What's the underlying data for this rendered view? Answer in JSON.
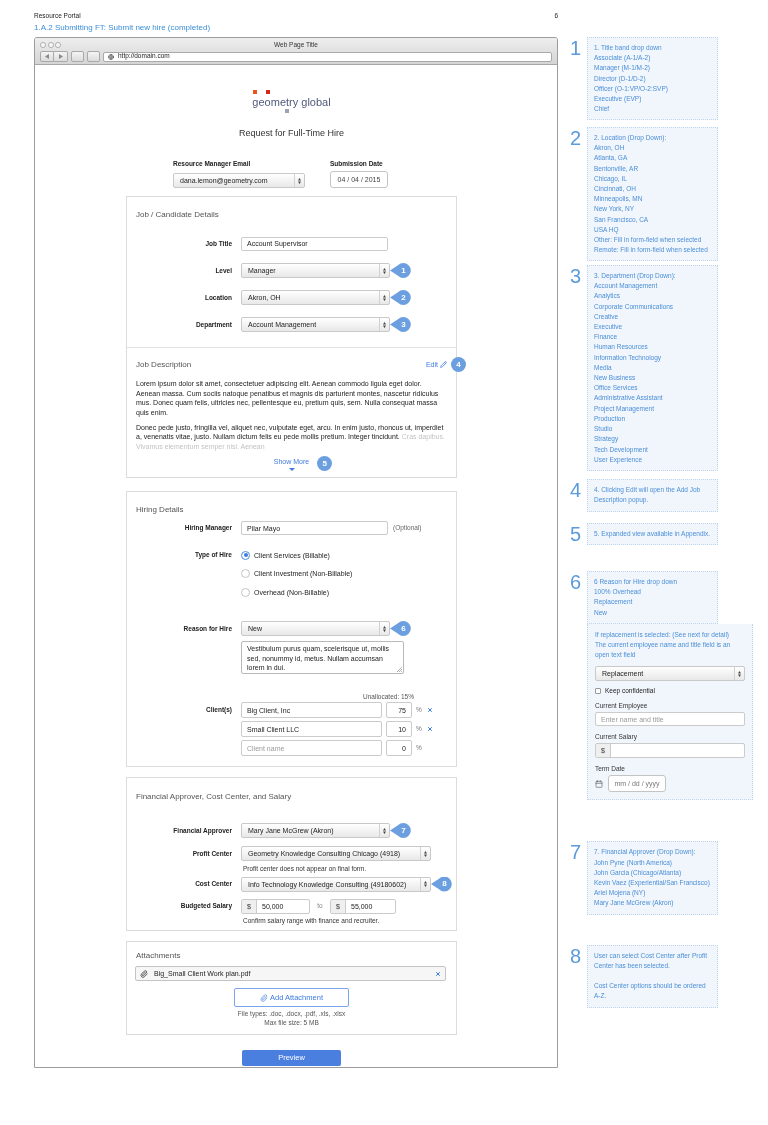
{
  "document": {
    "title": "Resource Portal",
    "page_number": "6",
    "subtitle": "1.A.2 Submitting FT: Submit new hire (completed)"
  },
  "browser": {
    "title": "Web Page Title",
    "url": "http://domain.com"
  },
  "form": {
    "logo": "geometry global",
    "heading": "Request for Full-Time Hire",
    "header_fields": [
      {
        "label": "Resource Manager Email",
        "kind": "select",
        "value": "dana.lemon@geometry.com"
      },
      {
        "label": "Submission Date",
        "kind": "date",
        "value": "04 / 04 / 2015"
      }
    ],
    "job_details": {
      "title": "Job / Candidate Details",
      "fields": [
        {
          "label": "Job Title",
          "kind": "text",
          "value": "Account Supervisor"
        },
        {
          "label": "Level",
          "kind": "select",
          "value": "Manager",
          "callout": "1"
        },
        {
          "label": "Location",
          "kind": "select",
          "value": "Akron, OH",
          "callout": "2"
        },
        {
          "label": "Department",
          "kind": "select",
          "value": "Account Management",
          "callout": "3"
        }
      ]
    },
    "job_description": {
      "title": "Job Description",
      "edit_link": "Edit",
      "callout": "4",
      "paragraphs": [
        "Lorem ipsum dolor sit amet, consectetuer adipiscing elit. Aenean commodo ligula eget dolor. Aenean massa. Cum sociis natoque penatibus et magnis dis parturient montes, nascetur ridiculus mus. Donec quam felis, ultricies nec, pellentesque eu, pretium quis, sem. Nulla consequat massa quis enim.",
        "Donec pede justo, fringilla vel, aliquet nec, vulputate eget, arcu. In enim justo, rhoncus ut, imperdiet a, venenatis vitae, justo. Nullam dictum felis eu pede mollis pretium. Integer tincidunt."
      ],
      "faded_text": "Cras dapibus. Vivamus elementum semper nisi. Aenean",
      "show_more": "Show More",
      "show_more_callout": "5"
    },
    "hiring_details": {
      "title": "Hiring Details",
      "hiring_manager": {
        "label": "Hiring Manager",
        "value": "Pilar Mayo",
        "note": "(Optional)"
      },
      "type_of_hire": {
        "label": "Type of Hire",
        "options": [
          {
            "label": "Client Services (Billable)",
            "selected": true
          },
          {
            "label": "Client Investment (Non-Billable)",
            "selected": false
          },
          {
            "label": "Overhead (Non-Billable)",
            "selected": false
          }
        ]
      },
      "reason_for_hire": {
        "label": "Reason for Hire",
        "value": "New",
        "callout": "6",
        "comment": "Vestibulum purus quam, scelerisque ut, mollis sed, nonummy id, metus. Nullam accumsan lorem in dui."
      },
      "clients": {
        "label": "Client(s)",
        "unallocated": "Unallocated: 15%",
        "rows": [
          {
            "name": "Big Client, Inc",
            "percent": "75",
            "unit": "%",
            "removable": true
          },
          {
            "name": "Small Client LLC",
            "percent": "10",
            "unit": "%",
            "removable": true
          },
          {
            "placeholder": "Client name",
            "percent": "0",
            "unit": "%",
            "removable": false
          }
        ]
      }
    },
    "financial": {
      "title": "Financial Approver, Cost Center, and Salary",
      "financial_approver": {
        "label": "Financial Approver",
        "value": "Mary Jane McGrew (Akron)",
        "callout": "7"
      },
      "profit_center": {
        "label": "Profit Center",
        "value": "Geometry Knowledge Consulting Chicago (4918)",
        "note": "Profit center does not appear on final form."
      },
      "cost_center": {
        "label": "Cost Center",
        "value": "Info Technology Knowledge Consulting (49180602)",
        "callout": "8"
      },
      "budgeted_salary": {
        "label": "Budgeted Salary",
        "min": {
          "prefix": "$",
          "value": "50,000"
        },
        "separator": "to",
        "max": {
          "prefix": "$",
          "value": "55,000"
        },
        "note": "Confirm salary range with finance and recruiter."
      }
    },
    "attachments": {
      "title": "Attachments",
      "files": [
        {
          "name": "Big_Small Client Work plan.pdf"
        }
      ],
      "add_button": "Add Attachment",
      "file_types": "File types: .doc, .docx, .pdf, .xls, .xlsx",
      "max_size": "Max file size: 5 MB"
    },
    "submit_button": "Preview"
  },
  "annotations": [
    {
      "number": "1",
      "kind": "list",
      "lines": [
        "1. Title band drop down",
        "Associate (A-1/A-2)",
        "Manager (M-1/M-2)",
        "Director (D-1/D-2)",
        "Officer (O-1:VP/O-2:SVP)",
        "Executive (EVP)",
        "Chief"
      ]
    },
    {
      "number": "2",
      "kind": "list",
      "lines": [
        "2. Location (Drop Down):",
        "Akron, OH",
        "Atlanta, GA",
        "Bentonville, AR",
        "Chicago, IL",
        "Cincinnati, OH",
        "Minneapolis, MN",
        "New York, NY",
        "San Francisco, CA",
        "USA HQ",
        "Other: Fill in form-field when selected",
        "Remote: Fill in form-field when selected"
      ]
    },
    {
      "number": "3",
      "kind": "list",
      "lines": [
        "3. Department (Drop Down):",
        "Account Management",
        "Analytics",
        "Corporate Communications",
        "Creative",
        "Executive",
        "Finance",
        "Human Resources",
        "Information Technology",
        "Media",
        "New Business",
        "Office Services",
        "Administrative Assistant",
        "Project Management",
        "Production",
        "Studio",
        "Strategy",
        "Tech Development",
        "User Experience"
      ]
    },
    {
      "number": "4",
      "kind": "note",
      "paragraphs": [
        "4. Clicking Edit will open the Add Job Description popup."
      ]
    },
    {
      "number": "5",
      "kind": "note",
      "paragraphs": [
        "5. Expanded view available in Appendix."
      ]
    },
    {
      "number": "6",
      "kind": "list",
      "lines": [
        "6 Reason for Hire drop down",
        "100% Overhead",
        "Replacement",
        "New"
      ],
      "detail": {
        "paragraphs": [
          "If replacement is selected: (See next for detail)",
          "The current employee name and title field is an open text field"
        ],
        "select": {
          "value": "Replacement"
        },
        "checkbox": {
          "label": "Keep confidential",
          "checked": false
        },
        "fields": [
          {
            "label": "Current Employee",
            "kind": "text",
            "placeholder": "Enter name and title"
          },
          {
            "label": "Current Salary",
            "kind": "currency",
            "prefix": "$"
          },
          {
            "label": "Term Date",
            "kind": "date",
            "placeholder": "mm / dd / yyyy"
          }
        ]
      }
    },
    {
      "number": "7",
      "kind": "list",
      "lines": [
        "7. Financial Approver (Drop Down):",
        "John Pyne (North America)",
        "John Garcia (Chicago/Atlanta)",
        "Kevin Vaez (Experiential/San Francisco)",
        "Ariel Mojena (NY)",
        "Mary Jane McGrew (Akron)"
      ]
    },
    {
      "number": "8",
      "kind": "note",
      "paragraphs": [
        "User can select Cost Center after Profit Center has been selected.",
        "Cost Center options should be ordered A-Z."
      ]
    }
  ]
}
